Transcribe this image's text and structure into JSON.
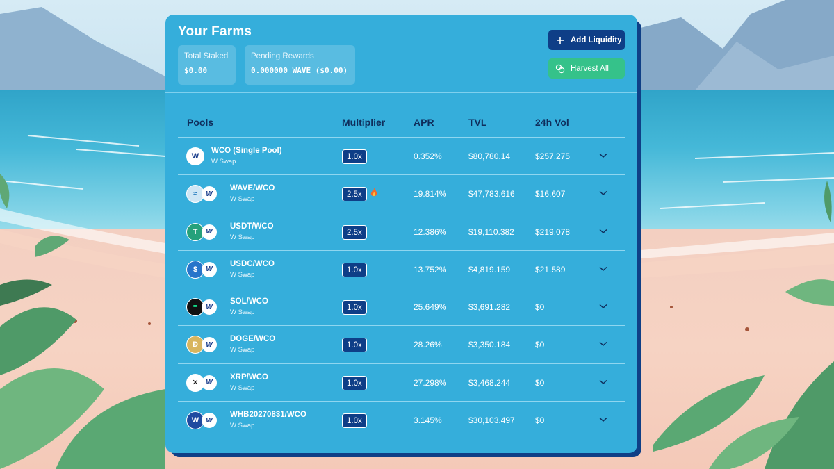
{
  "header": {
    "title": "Your Farms",
    "total_staked_label": "Total Staked",
    "total_staked_value": "$0.00",
    "pending_rewards_label": "Pending Rewards",
    "pending_rewards_value": "0.000000 WAVE ($0.00)",
    "add_liquidity_label": "Add Liquidity",
    "harvest_all_label": "Harvest All"
  },
  "table": {
    "columns": [
      "Pools",
      "Multiplier",
      "APR",
      "TVL",
      "24h Vol"
    ],
    "rows": [
      {
        "pool": "WCO (Single Pool)",
        "source": "W Swap",
        "multiplier": "1.0x",
        "hot": false,
        "apr": "0.352%",
        "tvl": "$80,780.14",
        "vol": "$257.275",
        "token_icon": "wco-token-icon",
        "single": true
      },
      {
        "pool": "WAVE/WCO",
        "source": "W Swap",
        "multiplier": "2.5x",
        "hot": true,
        "apr": "19.814%",
        "tvl": "$47,783.616",
        "vol": "$16.607",
        "token_icon": "wave-token-icon"
      },
      {
        "pool": "USDT/WCO",
        "source": "W Swap",
        "multiplier": "2.5x",
        "hot": false,
        "apr": "12.386%",
        "tvl": "$19,110.382",
        "vol": "$219.078",
        "token_icon": "usdt-token-icon"
      },
      {
        "pool": "USDC/WCO",
        "source": "W Swap",
        "multiplier": "1.0x",
        "hot": false,
        "apr": "13.752%",
        "tvl": "$4,819.159",
        "vol": "$21.589",
        "token_icon": "usdc-token-icon"
      },
      {
        "pool": "SOL/WCO",
        "source": "W Swap",
        "multiplier": "1.0x",
        "hot": false,
        "apr": "25.649%",
        "tvl": "$3,691.282",
        "vol": "$0",
        "token_icon": "sol-token-icon"
      },
      {
        "pool": "DOGE/WCO",
        "source": "W Swap",
        "multiplier": "1.0x",
        "hot": false,
        "apr": "28.26%",
        "tvl": "$3,350.184",
        "vol": "$0",
        "token_icon": "doge-token-icon"
      },
      {
        "pool": "XRP/WCO",
        "source": "W Swap",
        "multiplier": "1.0x",
        "hot": false,
        "apr": "27.298%",
        "tvl": "$3,468.244",
        "vol": "$0",
        "token_icon": "xrp-token-icon"
      },
      {
        "pool": "WHB20270831/WCO",
        "source": "W Swap",
        "multiplier": "1.0x",
        "hot": false,
        "apr": "3.145%",
        "tvl": "$30,103.497",
        "vol": "$0",
        "token_icon": "whb-token-icon"
      }
    ]
  },
  "colors": {
    "card_bg": "#35aedb",
    "card_shadow": "#0f3f86",
    "header_text_dark": "#0f2e5c",
    "primary_button": "#0e3e87",
    "harvest_button": "#35c28a"
  },
  "icons": {
    "add": "plus-icon",
    "harvest": "coins-icon",
    "expand": "chevron-down-icon",
    "hot": "fire-icon"
  }
}
